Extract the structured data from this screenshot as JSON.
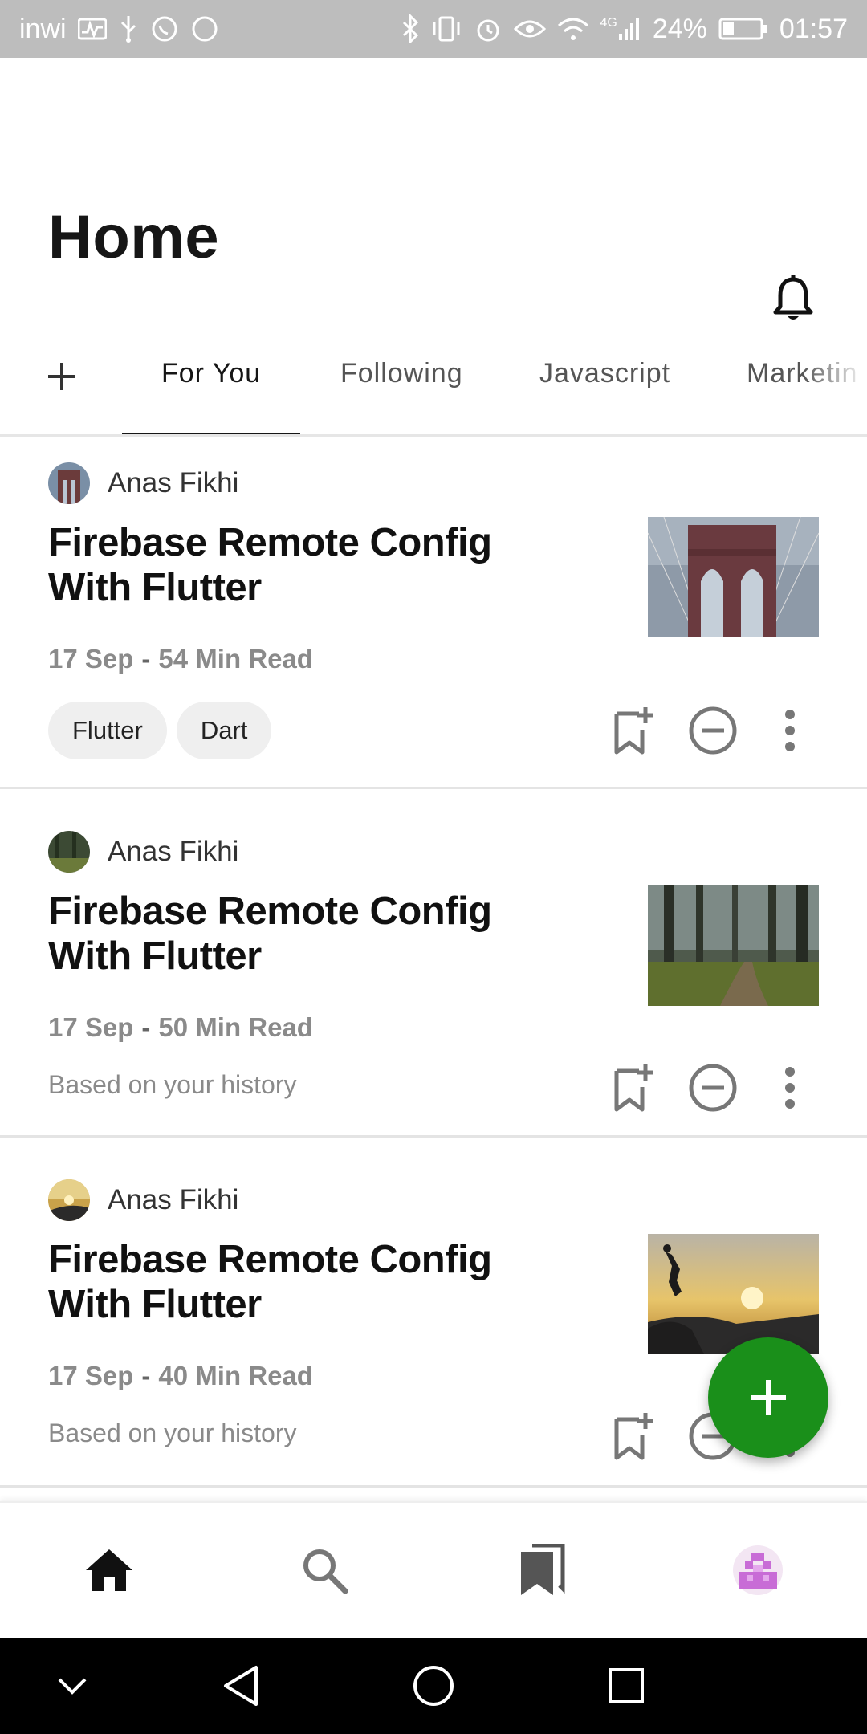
{
  "status_bar": {
    "carrier": "inwi",
    "network": "4G",
    "battery": "24%",
    "time": "01:57"
  },
  "header": {
    "title": "Home",
    "notification_icon": "bell-icon"
  },
  "tabs": {
    "add_icon": "plus-icon",
    "items": [
      {
        "label": "For You",
        "active": true
      },
      {
        "label": "Following",
        "active": false
      },
      {
        "label": "Javascript",
        "active": false
      },
      {
        "label": "Marketin",
        "active": false
      }
    ]
  },
  "articles": [
    {
      "author": "Anas Fikhi",
      "title": "Firebase Remote Config With Flutter",
      "date": "17 Sep",
      "separator": "-",
      "read_time": "54 Min Read",
      "tags": [
        "Flutter",
        "Dart"
      ],
      "footer_note": "",
      "thumbnail": "bridge-photo"
    },
    {
      "author": "Anas Fikhi",
      "title": "Firebase Remote Config With Flutter",
      "date": "17 Sep",
      "separator": "-",
      "read_time": "50 Min Read",
      "tags": [],
      "footer_note": "Based on your history",
      "thumbnail": "forest-path-photo"
    },
    {
      "author": "Anas Fikhi",
      "title": "Firebase Remote Config With Flutter",
      "date": "17 Sep",
      "separator": "-",
      "read_time": "40 Min Read",
      "tags": [],
      "footer_note": "Based on your history",
      "thumbnail": "sunset-jump-photo"
    }
  ],
  "fab": {
    "icon": "plus-icon",
    "color": "#1a8f1a"
  },
  "bottom_nav": [
    "home-icon",
    "search-icon",
    "bookmarks-icon",
    "profile-avatar"
  ],
  "system_nav": [
    "collapse-icon",
    "back-icon",
    "home-circle-icon",
    "recents-icon"
  ]
}
